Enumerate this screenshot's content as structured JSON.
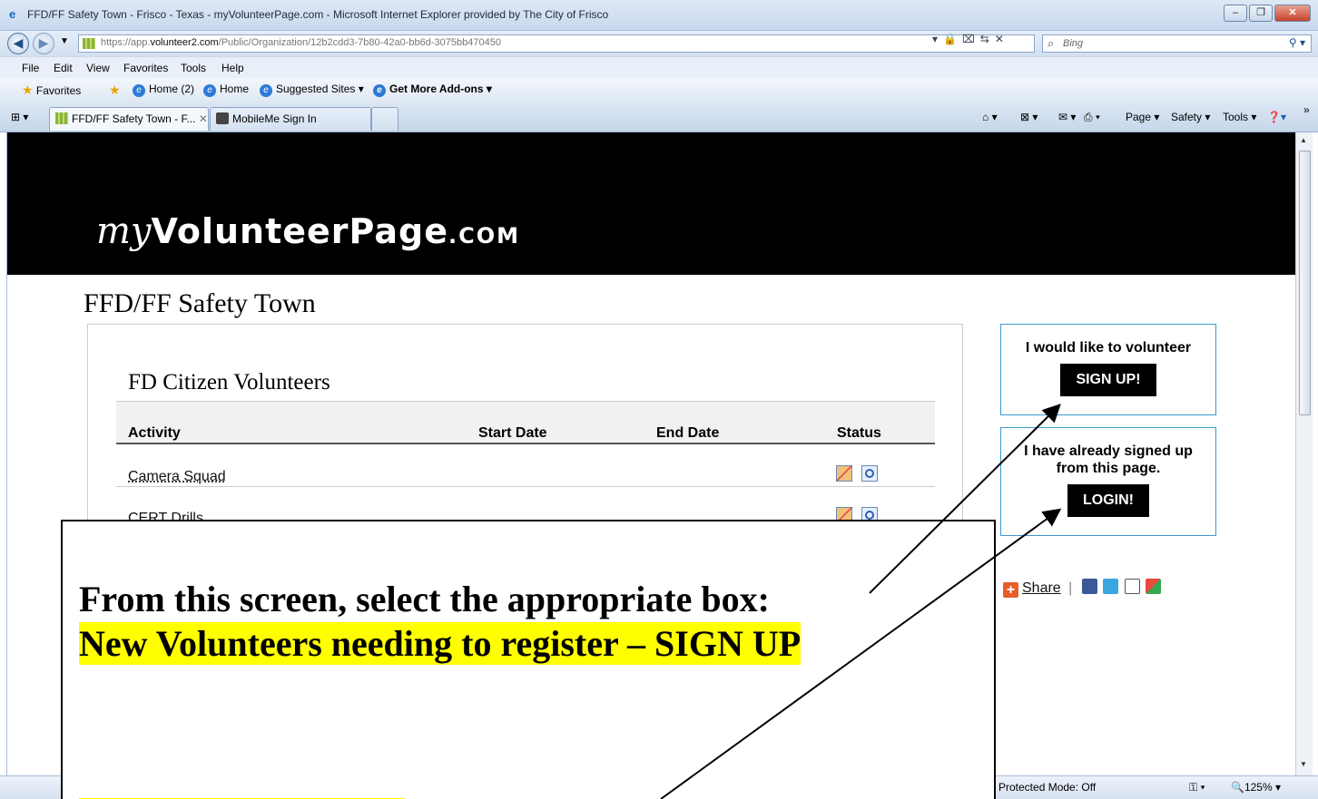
{
  "browser": {
    "window_title": "FFD/FF Safety Town - Frisco - Texas - myVolunteerPage.com - Microsoft Internet Explorer provided by The City of Frisco",
    "url_prefix": "https://app.",
    "url_domain": "volunteer2.com",
    "url_path": "/Public/Organization/12b2cdd3-7b80-42a0-bb6d-3075bb470450",
    "search_placeholder": "Bing",
    "menu": [
      "File",
      "Edit",
      "View",
      "Favorites",
      "Tools",
      "Help"
    ],
    "favorites_label": "Favorites",
    "fav_links": [
      "Home (2)",
      "Home",
      "Suggested Sites ▾",
      "Get More Add-ons ▾"
    ],
    "tabs": [
      "FFD/FF Safety Town - F...",
      "MobileMe Sign In"
    ],
    "commands": [
      "Page ▾",
      "Safety ▾",
      "Tools ▾"
    ],
    "status_protected": "Protected Mode: Off",
    "zoom": "125%"
  },
  "page": {
    "logo_my": "my",
    "logo_volunteer_page": "VolunteerPage",
    "logo_com": ".COM",
    "org_title": "FFD/FF Safety Town",
    "group_title": "FD Citizen Volunteers",
    "columns": [
      "Activity",
      "Start Date",
      "End Date",
      "Status"
    ],
    "activities": [
      "Camera Squad",
      "CERT Drills"
    ],
    "volunteer_box": {
      "text": "I would like to volunteer",
      "button": "SIGN UP!"
    },
    "login_box": {
      "line1": "I have already signed up",
      "line2": "from this page.",
      "button": "LOGIN!"
    },
    "share_label": "Share"
  },
  "annotation": {
    "line1": "From this screen, select the appropriate box:",
    "line2": "New Volunteers needing to register – SIGN UP"
  },
  "colors": {
    "highlight": "#ffff00",
    "box_border": "#3a9ad0",
    "banner": "#000000"
  }
}
